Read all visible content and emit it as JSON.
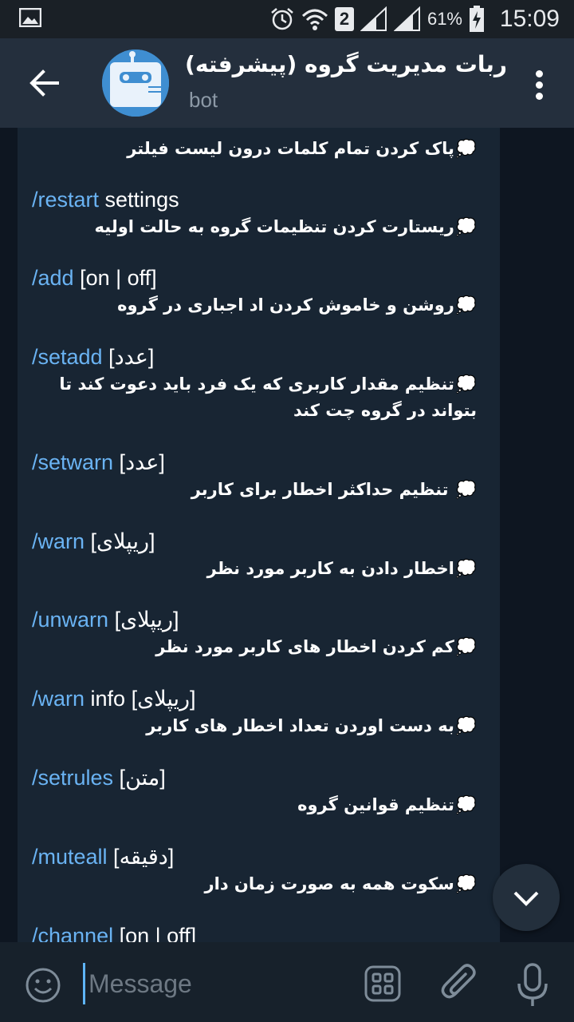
{
  "status_bar": {
    "battery_percent": "61%",
    "time": "15:09",
    "sim_badge": "2",
    "icons": [
      "gallery-icon",
      "alarm-icon",
      "wifi-icon",
      "signal-icon",
      "signal-icon-2",
      "battery-charging-icon"
    ]
  },
  "header": {
    "title": "ربات مدیریت گروه (پیشرفته)",
    "subtitle": "bot",
    "back_icon": "arrow-left-icon",
    "menu_icon": "more-vertical-icon"
  },
  "message": {
    "bullet_icon": "💭",
    "partial_top_desc": "پاک کردن تمام کلمات درون لیست فیلتر",
    "commands": [
      {
        "cmd": "/restart",
        "arg": " settings",
        "desc": "ریستارت کردن تنظیمات گروه به حالت اولیه"
      },
      {
        "cmd": "/add",
        "arg": " [on | off]",
        "desc": "روشن و خاموش کردن اد اجباری در گروه"
      },
      {
        "cmd": "/setadd",
        "arg": " [عدد]",
        "desc": "تنظیم مقدار کاربری که یک فرد باید دعوت کند تا بتواند در گروه چت کند"
      },
      {
        "cmd": "/setwarn",
        "arg": " [عدد]",
        "desc": " تنظیم حداکثر اخطار برای کاربر"
      },
      {
        "cmd": "/warn",
        "arg": " [ریپلای]",
        "desc": "اخطار دادن به کاربر مورد نظر"
      },
      {
        "cmd": "/unwarn",
        "arg": " [ریپلای]",
        "desc": "کم کردن اخطار های کاربر مورد نظر"
      },
      {
        "cmd": "/warn",
        "arg": " info [ریپلای]",
        "desc": "به دست اوردن تعداد اخطار های کاربر"
      },
      {
        "cmd": "/setrules",
        "arg": " [متن]",
        "desc": "تنظیم قوانین گروه"
      },
      {
        "cmd": "/muteall",
        "arg": " [دقیقه]",
        "desc": "سکوت همه به صورت زمان دار"
      },
      {
        "cmd": "/channel",
        "arg": " [on | off]",
        "desc": ""
      }
    ]
  },
  "input_bar": {
    "placeholder": "Message",
    "icons": [
      "emoji-icon",
      "bot-commands-icon",
      "attach-icon",
      "microphone-icon"
    ]
  },
  "scroll_button_icon": "chevron-down-icon",
  "colors": {
    "header_bg": "#242f3d",
    "chat_bg": "#0e1621",
    "bubble_bg": "#182533",
    "command_link": "#6ab3f3",
    "input_bg": "#17212b"
  }
}
